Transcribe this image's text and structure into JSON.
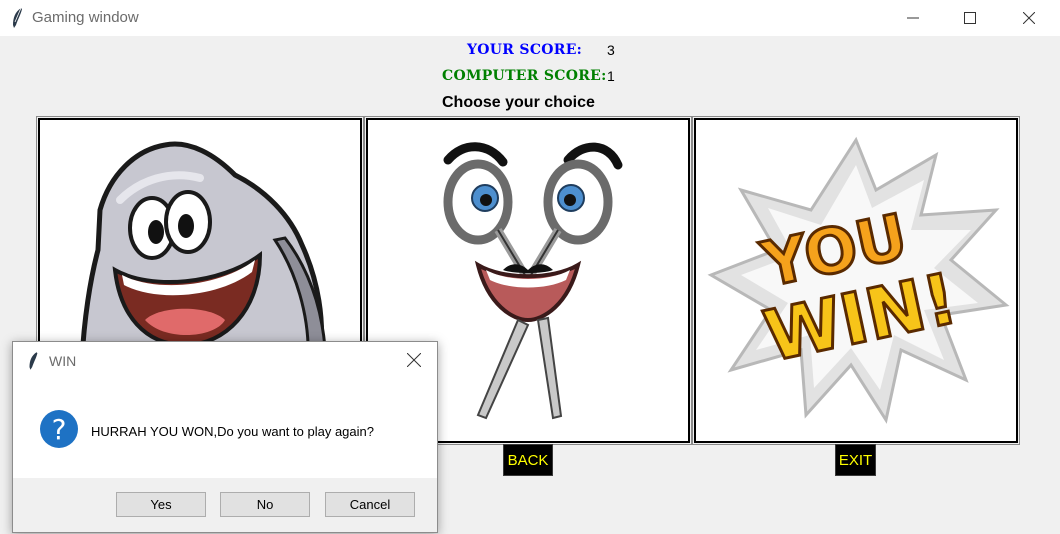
{
  "window": {
    "title": "Gaming window"
  },
  "scores": {
    "your_label": "YOUR SCORE:",
    "your_value": "3",
    "computer_label": "COMPUTER SCORE:",
    "computer_value": "1"
  },
  "prompt": "Choose your choice",
  "panels": [
    {
      "name": "rock",
      "icon": "rock-cartoon"
    },
    {
      "name": "scissors",
      "icon": "scissors-cartoon"
    },
    {
      "name": "result",
      "icon": "you-win-burst"
    }
  ],
  "win_art_text": {
    "line1": "YOU",
    "line2": "WIN!"
  },
  "buttons": {
    "back": "BACK",
    "exit": "EXIT"
  },
  "dialog": {
    "title": "WIN",
    "message": "HURRAH YOU WON,Do you want to play again?",
    "yes": "Yes",
    "no": "No",
    "cancel": "Cancel"
  },
  "colors": {
    "your_score": "#0000ff",
    "computer_score": "#008000",
    "button_bg": "#000000",
    "button_text": "#ffff00",
    "question_icon": "#1e72c4"
  }
}
